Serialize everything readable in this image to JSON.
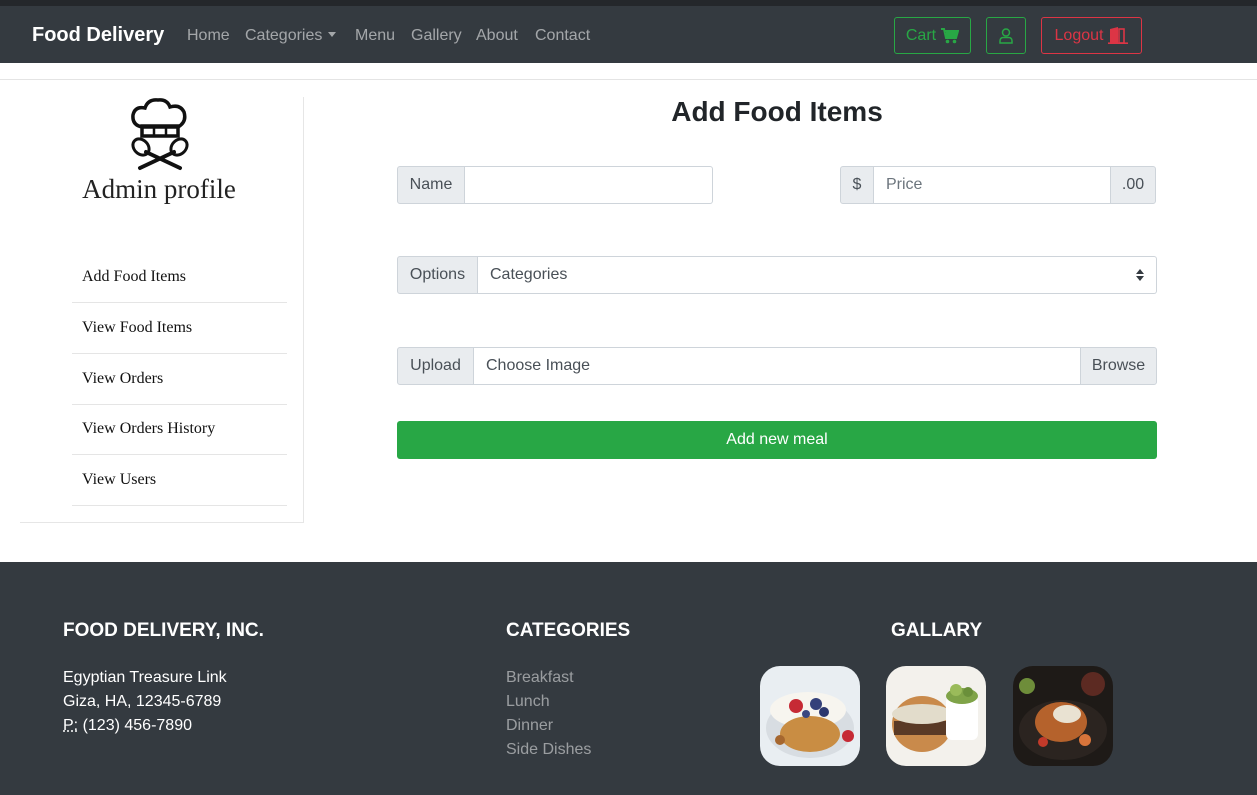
{
  "navbar": {
    "brand": "Food Delivery",
    "links": [
      "Home",
      "Categories",
      "Menu",
      "Gallery",
      "About",
      "Contact"
    ],
    "cart_label": "Cart",
    "logout_label": "Logout"
  },
  "sidebar": {
    "title": "Admin profile",
    "items": [
      "Add Food Items",
      "View Food Items",
      "View Orders",
      "View Orders History",
      "View Users"
    ]
  },
  "form": {
    "title": "Add Food Items",
    "name_label": "Name",
    "name_value": "",
    "price_prefix": "$",
    "price_placeholder": "Price",
    "price_suffix": ".00",
    "options_label": "Options",
    "category_selected": "Categories",
    "upload_label": "Upload",
    "upload_placeholder": "Choose Image",
    "browse_label": "Browse",
    "submit_label": "Add new meal"
  },
  "footer": {
    "company_heading": "FOOD DELIVERY, INC.",
    "address_line1": "Egyptian Treasure Link",
    "address_line2": "Giza, HA, 12345-6789",
    "phone_prefix": "P:",
    "phone": "(123) 456-7890",
    "categories_heading": "CATEGORIES",
    "categories": [
      "Breakfast",
      "Lunch",
      "Dinner",
      "Side Dishes"
    ],
    "gallery_heading": "GALLARY"
  },
  "colors": {
    "navbar_bg": "#343a40",
    "success": "#28a745",
    "danger": "#dc3545"
  },
  "icons": [
    "cart-icon",
    "user-icon",
    "door-exit-icon",
    "chef-hat-logo-icon",
    "select-arrows-icon"
  ]
}
